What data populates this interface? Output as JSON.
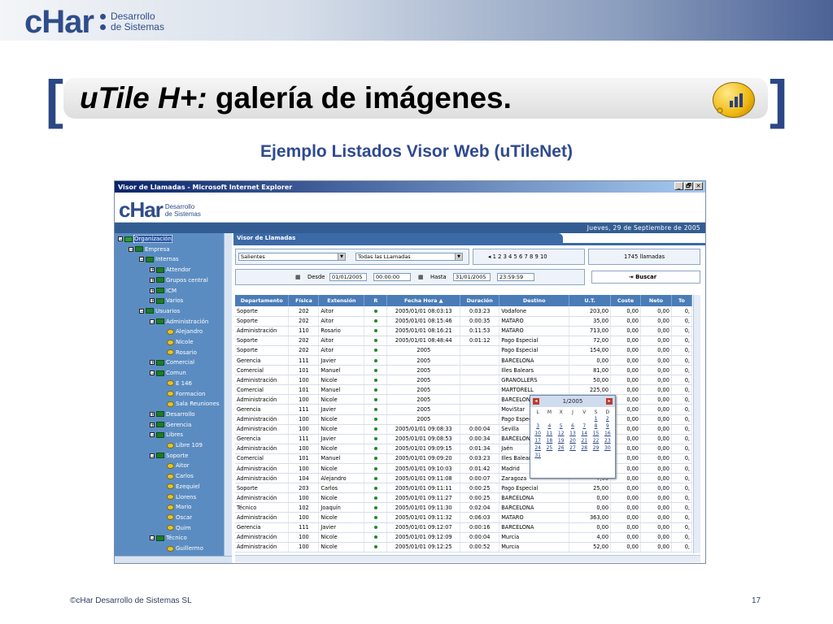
{
  "slide": {
    "logo": {
      "mark": "cHar",
      "line1": "Desarrollo",
      "line2": "de Sistemas"
    },
    "title_italic": "uTile H+:",
    "title_rest": " galería de imágenes.",
    "subtitle": "Ejemplo Listados Visor Web (uTileNet)",
    "footer_left": "©cHar Desarrollo de Sistemas SL",
    "footer_right": "17"
  },
  "browser": {
    "window_title": "Visor de Llamadas - Microsoft Internet Explorer",
    "buttons": [
      "_",
      "🗗",
      "✕"
    ],
    "header_logo": {
      "mark": "cHar",
      "line1": "Desarrollo",
      "line2": "de Sistemas"
    },
    "date": "Jueves, 29 de Septiembre de 2005"
  },
  "tree": [
    {
      "label": "Organización",
      "icon": "root",
      "pm": "−",
      "sel": true
    },
    {
      "label": "Empresa",
      "icon": "folder",
      "pm": "−"
    },
    {
      "label": "Internas",
      "icon": "folder",
      "pm": "−"
    },
    {
      "label": "Attendor",
      "icon": "folder",
      "pm": "+"
    },
    {
      "label": "Grupos central",
      "icon": "folder",
      "pm": "+"
    },
    {
      "label": "ICM",
      "icon": "folder",
      "pm": "+"
    },
    {
      "label": "Varios",
      "icon": "folder",
      "pm": "+"
    },
    {
      "label": "Usuarios",
      "icon": "folder",
      "pm": "−"
    },
    {
      "label": "Administración",
      "icon": "folder",
      "pm": "−"
    },
    {
      "label": "Alejandro",
      "icon": "phone",
      "pm": ""
    },
    {
      "label": "Nicole",
      "icon": "phone",
      "pm": ""
    },
    {
      "label": "Rosario",
      "icon": "phone",
      "pm": ""
    },
    {
      "label": "Comercial",
      "icon": "folder",
      "pm": "+"
    },
    {
      "label": "Comun",
      "icon": "folder",
      "pm": "−"
    },
    {
      "label": "E 146",
      "icon": "phone",
      "pm": ""
    },
    {
      "label": "Formacion",
      "icon": "phone",
      "pm": ""
    },
    {
      "label": "Sala Reuniones",
      "icon": "phone",
      "pm": ""
    },
    {
      "label": "Desarrollo",
      "icon": "folder",
      "pm": "+"
    },
    {
      "label": "Gerencia",
      "icon": "folder",
      "pm": "+"
    },
    {
      "label": "Libres",
      "icon": "folder",
      "pm": "−"
    },
    {
      "label": "Libre 109",
      "icon": "phone",
      "pm": ""
    },
    {
      "label": "Soporte",
      "icon": "folder",
      "pm": "−"
    },
    {
      "label": "Aitor",
      "icon": "phone",
      "pm": ""
    },
    {
      "label": "Carlos",
      "icon": "phone",
      "pm": ""
    },
    {
      "label": "Ezequiel",
      "icon": "phone",
      "pm": ""
    },
    {
      "label": "Llorens",
      "icon": "phone",
      "pm": ""
    },
    {
      "label": "Mario",
      "icon": "phone",
      "pm": ""
    },
    {
      "label": "Oscar",
      "icon": "phone",
      "pm": ""
    },
    {
      "label": "Quim",
      "icon": "phone",
      "pm": ""
    },
    {
      "label": "Técnico",
      "icon": "folder",
      "pm": "−"
    },
    {
      "label": "Guillermo",
      "icon": "phone",
      "pm": ""
    }
  ],
  "panel": {
    "tab": "Visor de Llamadas",
    "direction_select": "Salientes",
    "type_select": "Todas las LLamadas",
    "pages": "1 2 3 4 5 6 7 8 9 10",
    "calls_count": "1745 llamadas",
    "from_label": "Desde",
    "from_date": "01/01/2005",
    "from_time": "00:00:00",
    "to_label": "Hasta",
    "to_date": "31/01/2005",
    "to_time": "23:59:59",
    "search_label": "Buscar"
  },
  "calendar": {
    "month": "1/2005",
    "weekdays": [
      "L",
      "M",
      "X",
      "J",
      "V",
      "S",
      "D"
    ],
    "days": [
      "",
      "",
      "",
      "",
      "",
      "1",
      "2",
      "3",
      "4",
      "5",
      "6",
      "7",
      "8",
      "9",
      "10",
      "11",
      "12",
      "13",
      "14",
      "15",
      "16",
      "17",
      "18",
      "19",
      "20",
      "21",
      "22",
      "23",
      "24",
      "25",
      "26",
      "27",
      "28",
      "29",
      "30",
      "31"
    ]
  },
  "table": {
    "columns": [
      "Departamento",
      "Física",
      "Extensión",
      "R",
      "Fecha Hora ▲",
      "Duración",
      "Destino",
      "U.T.",
      "Coste",
      "Neto",
      "To"
    ],
    "rows": [
      [
        "Soporte",
        "202",
        "Aitor",
        "2005/01/01 08:03:13",
        "0:03:23",
        "Vodafone",
        "203,00",
        "0,00",
        "0,00",
        "0,"
      ],
      [
        "Soporte",
        "202",
        "Aitor",
        "2005/01/01 08:15:46",
        "0:00:35",
        "MATARO",
        "35,00",
        "0,00",
        "0,00",
        "0,"
      ],
      [
        "Administración",
        "110",
        "Rosario",
        "2005/01/01 08:16:21",
        "0:11:53",
        "MATARO",
        "713,00",
        "0,00",
        "0,00",
        "0,"
      ],
      [
        "Soporte",
        "202",
        "Aitor",
        "2005/01/01 08:48:44",
        "0:01:12",
        "Pago Especial",
        "72,00",
        "0,00",
        "0,00",
        "0,"
      ],
      [
        "Soporte",
        "202",
        "Aitor",
        "2005",
        "",
        "Pago Especial",
        "154,00",
        "0,00",
        "0,00",
        "0,"
      ],
      [
        "Gerencia",
        "111",
        "Javier",
        "2005",
        "",
        "BARCELONA",
        "0,00",
        "0,00",
        "0,00",
        "0,"
      ],
      [
        "Comercial",
        "101",
        "Manuel",
        "2005",
        "",
        "Illes Balears",
        "81,00",
        "0,00",
        "0,00",
        "0,"
      ],
      [
        "Administración",
        "100",
        "Nicole",
        "2005",
        "",
        "GRANOLLERS",
        "50,00",
        "0,00",
        "0,00",
        "0,"
      ],
      [
        "Comercial",
        "101",
        "Manuel",
        "2005",
        "",
        "MARTORELL",
        "225,00",
        "0,00",
        "0,00",
        "0,"
      ],
      [
        "Administración",
        "100",
        "Nicole",
        "2005",
        "",
        "BARCELONA",
        "0,00",
        "0,00",
        "0,00",
        "0,"
      ],
      [
        "Gerencia",
        "111",
        "Javier",
        "2005",
        "",
        "MoviStar",
        "212,00",
        "0,00",
        "0,00",
        "0,"
      ],
      [
        "Administración",
        "100",
        "Nicole",
        "2005",
        "",
        "Pago Especial",
        "49,00",
        "0,00",
        "0,00",
        "0,"
      ],
      [
        "Administración",
        "100",
        "Nicole",
        "2005/01/01 09:08:33",
        "0:00:04",
        "Sevilla",
        "4,00",
        "0,00",
        "0,00",
        "0,"
      ],
      [
        "Gerencia",
        "111",
        "Javier",
        "2005/01/01 09:08:53",
        "0:00:34",
        "BARCELONA",
        "0,00",
        "0,00",
        "0,00",
        "0,"
      ],
      [
        "Administración",
        "100",
        "Nicole",
        "2005/01/01 09:09:15",
        "0:01:34",
        "Jaén",
        "94,00",
        "0,00",
        "0,00",
        "0,"
      ],
      [
        "Comercial",
        "101",
        "Manuel",
        "2005/01/01 09:09:20",
        "0:03:23",
        "Illes Balears",
        "203,00",
        "0,00",
        "0,00",
        "0,"
      ],
      [
        "Administración",
        "100",
        "Nicole",
        "2005/01/01 09:10:03",
        "0:01:42",
        "Madrid",
        "102,00",
        "0,00",
        "0,00",
        "0,"
      ],
      [
        "Administración",
        "104",
        "Alejandro",
        "2005/01/01 09:11:08",
        "0:00:07",
        "Zaragoza",
        "7,00",
        "0,00",
        "0,00",
        "0,"
      ],
      [
        "Soporte",
        "203",
        "Carlos",
        "2005/01/01 09:11:11",
        "0:00:25",
        "Pago Especial",
        "25,00",
        "0,00",
        "0,00",
        "0,"
      ],
      [
        "Administración",
        "100",
        "Nicole",
        "2005/01/01 09:11:27",
        "0:00:25",
        "BARCELONA",
        "0,00",
        "0,00",
        "0,00",
        "0,"
      ],
      [
        "Técnico",
        "102",
        "Joaquín",
        "2005/01/01 09:11:30",
        "0:02:04",
        "BARCELONA",
        "0,00",
        "0,00",
        "0,00",
        "0,"
      ],
      [
        "Administración",
        "100",
        "Nicole",
        "2005/01/01 09:11:32",
        "0:06:03",
        "MATARO",
        "363,00",
        "0,00",
        "0,00",
        "0,"
      ],
      [
        "Gerencia",
        "111",
        "Javier",
        "2005/01/01 09:12:07",
        "0:00:16",
        "BARCELONA",
        "0,00",
        "0,00",
        "0,00",
        "0,"
      ],
      [
        "Administración",
        "100",
        "Nicole",
        "2005/01/01 09:12:09",
        "0:00:04",
        "Murcia",
        "4,00",
        "0,00",
        "0,00",
        "0,"
      ],
      [
        "Administración",
        "100",
        "Nicole",
        "2005/01/01 09:12:25",
        "0:00:52",
        "Murcia",
        "52,00",
        "0,00",
        "0,00",
        "0,"
      ]
    ]
  }
}
